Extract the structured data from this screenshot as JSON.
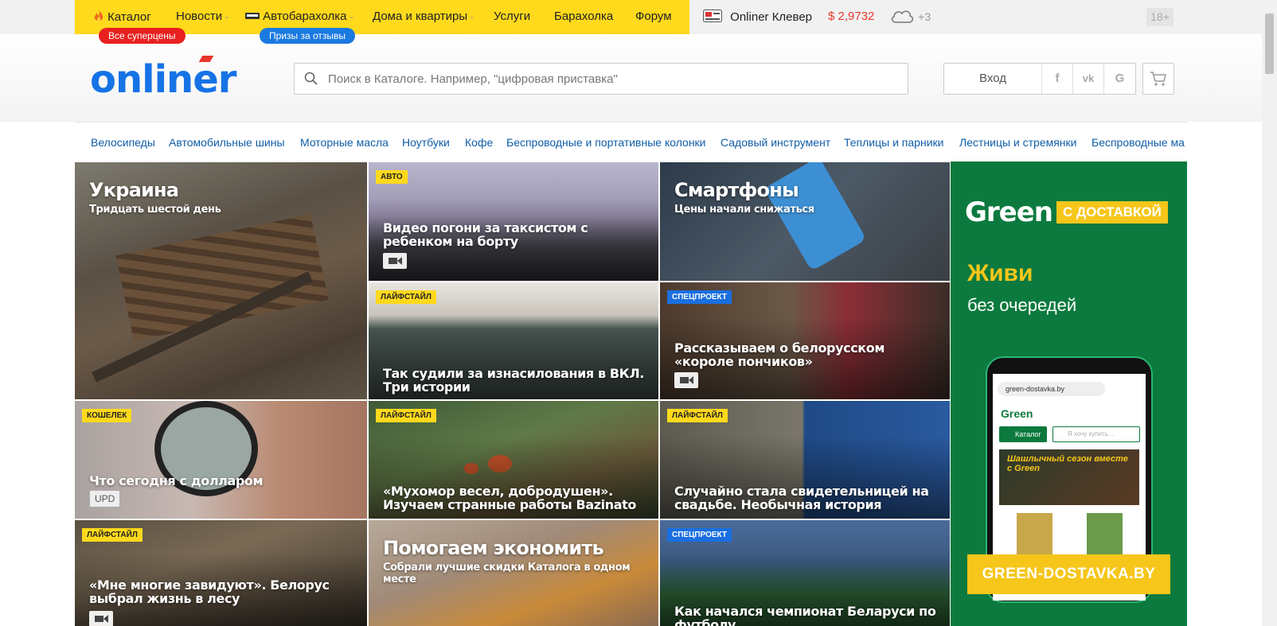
{
  "topbar": {
    "nav": [
      {
        "label": "Каталог",
        "icon": "fire-icon"
      },
      {
        "label": "Новости",
        "dropdown": true
      },
      {
        "label": "Автобарахолка",
        "icon": "car-icon",
        "dropdown": true
      },
      {
        "label": "Дома и квартиры",
        "dropdown": true
      },
      {
        "label": "Услуги"
      },
      {
        "label": "Барахолка"
      },
      {
        "label": "Форум"
      }
    ],
    "badges": {
      "catalog": "Все суперцены",
      "auto": "Призы за отзывы"
    },
    "clever": "Onliner Клевер",
    "currency": "$ 2,9732",
    "weather": "+3",
    "age": "18+",
    "colors": {
      "yellow": "#ffd91c",
      "red_badge": "#e8211f",
      "blue_badge": "#1a7ae0",
      "currency": "#e8372c"
    }
  },
  "header": {
    "logo": "onliner",
    "search_placeholder": "Поиск в Каталоге. Например, \"цифровая приставка\"",
    "login": "Вход",
    "social": [
      "f",
      "vk",
      "G"
    ]
  },
  "catnav": [
    "Велосипеды",
    "Автомобильные шины",
    "Моторные масла",
    "Ноутбуки",
    "Кофе",
    "Беспроводные и портативные колонки",
    "Садовый инструмент",
    "Теплицы и парники",
    "Лестницы и стремянки",
    "Беспроводные ма"
  ],
  "tiles": {
    "ukraine": {
      "title": "Украина",
      "subtitle": "Тридцать шестой день"
    },
    "taxi": {
      "tag": "АВТО",
      "title": "Видео погони за таксистом с ребенком на борту"
    },
    "phones": {
      "title": "Смартфоны",
      "subtitle": "Цены начали снижаться"
    },
    "court": {
      "tag": "ЛАЙФСТАЙЛ",
      "title": "Так судили за изнасилования в ВКЛ. Три истории"
    },
    "donuts": {
      "tag": "СПЕЦПРОЕКТ",
      "title": "Рассказываем о белорусском «короле пончиков»"
    },
    "dollar": {
      "tag": "КОШЕЛЕК",
      "title": "Что сегодня с долларом",
      "badge": "UPD"
    },
    "mushroom": {
      "tag": "ЛАЙФСТАЙЛ",
      "title": "«Мухомор весел, добродушен». Изучаем странные работы Bazinato"
    },
    "wedding": {
      "tag": "ЛАЙФСТАЙЛ",
      "title": "Случайно стала свидетельницей на свадьбе. Необычная история"
    },
    "forest": {
      "tag": "ЛАЙФСТАЙЛ",
      "title": "«Мне многие завидуют». Белорус выбрал жизнь в лесу"
    },
    "save": {
      "title": "Помогаем экономить",
      "subtitle": "Собрали лучшие скидки Каталога в одном месте"
    },
    "football": {
      "tag": "СПЕЦПРОЕКТ",
      "title": "Как начался чемпионат Беларуси по футболу"
    }
  },
  "ad": {
    "brand": "Green",
    "delivery": "С ДОСТАВКОЙ",
    "headline": "Живи",
    "subline": "без очередей",
    "url_bar": "green-dostavka.by",
    "catalog_btn": "Каталог",
    "search_ph": "Я хочу купить...",
    "banner_text": "Шашлычный сезон вместе с Green",
    "cta": "GREEN-DOSTAVKA.BY",
    "colors": {
      "bg": "#0c7a3e",
      "accent": "#f6c61a"
    }
  }
}
